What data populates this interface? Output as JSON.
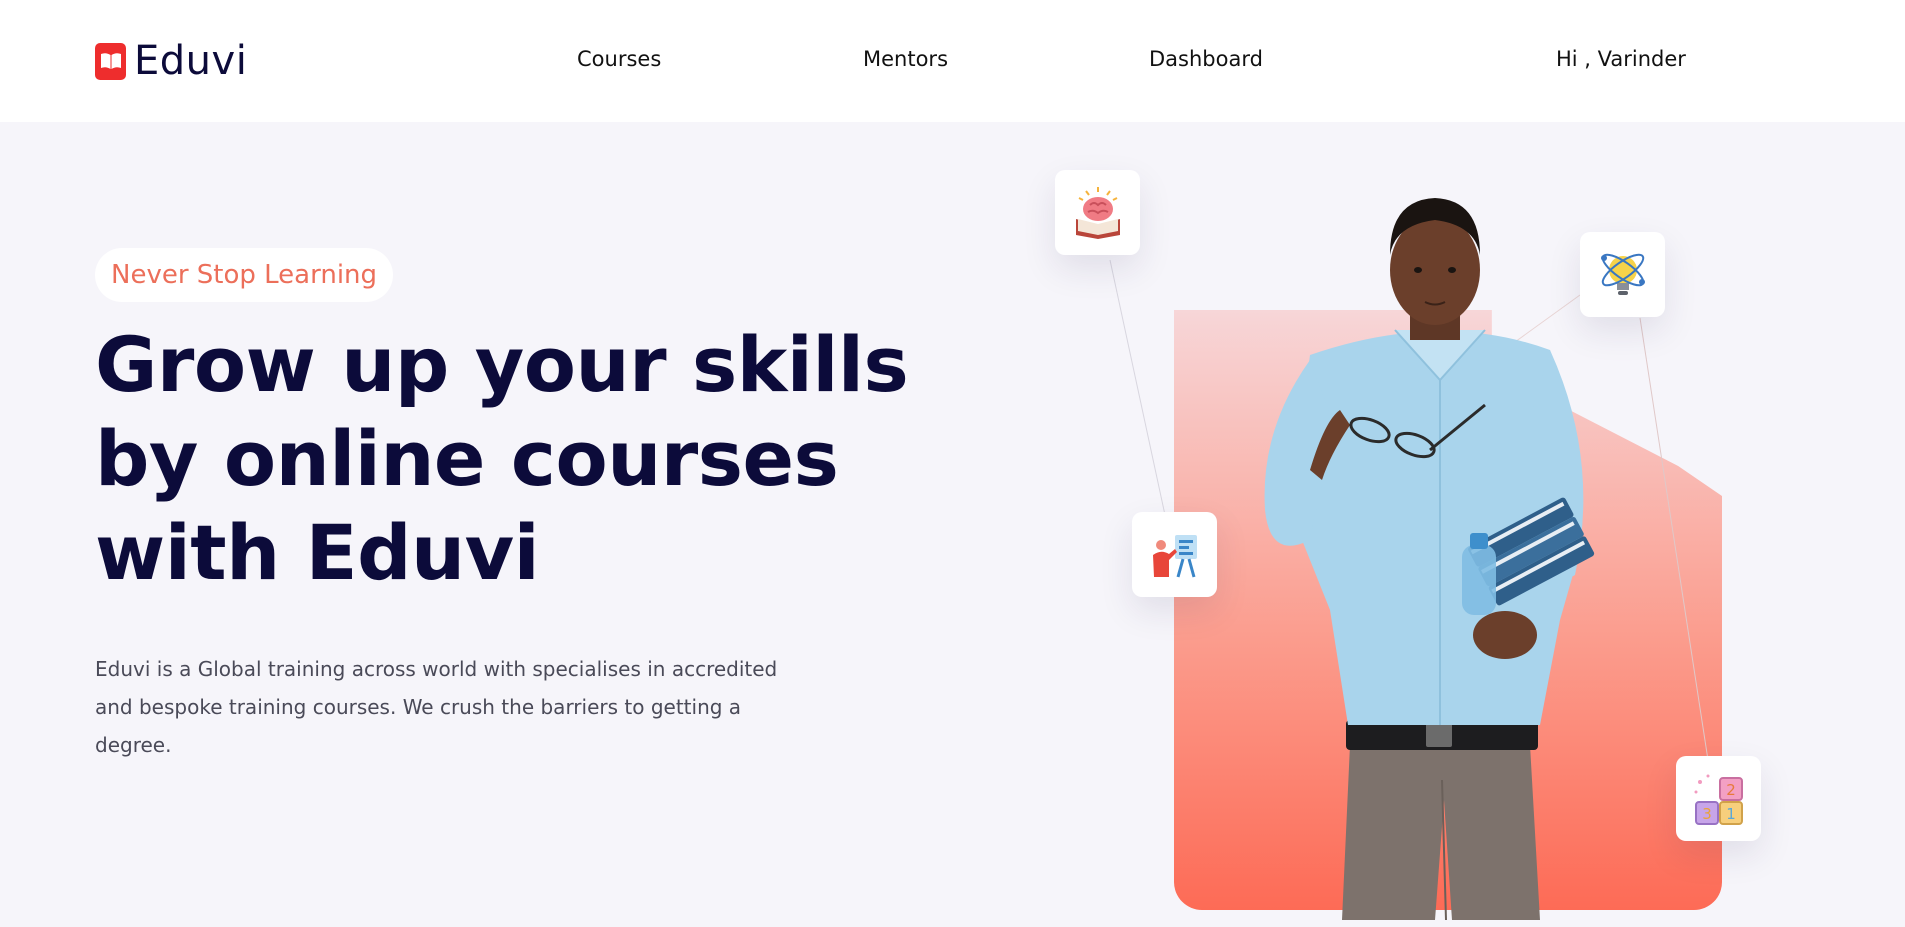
{
  "brand": {
    "name": "Eduvi",
    "accent_color": "#ee2d2d",
    "logo_icon": "open-book-icon"
  },
  "nav": {
    "courses": "Courses",
    "mentors": "Mentors",
    "dashboard": "Dashboard",
    "greeting": "Hi , Varinder"
  },
  "hero": {
    "badge": "Never Stop Learning",
    "headline_line1": "Grow up your skills",
    "headline_line2": "by online courses",
    "headline_line3": "with Eduvi",
    "description": "Eduvi is a Global training across world with specialises in accredited and bespoke training courses. We crush the barriers to getting a degree.",
    "heading_color": "#0c0b3a",
    "badge_color": "#ec6f5a",
    "gradient_colors": [
      "#f7d6d8",
      "#fd6b56"
    ]
  },
  "floating_icons": [
    "brain-book-icon",
    "lightbulb-atom-icon",
    "teacher-board-icon",
    "number-blocks-icon"
  ]
}
